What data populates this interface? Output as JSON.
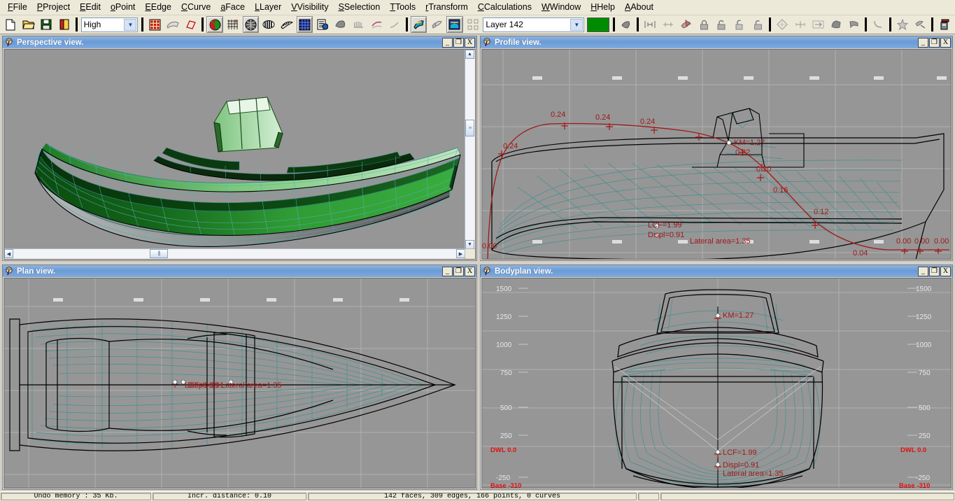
{
  "app": {
    "title": "Hull Design"
  },
  "menubar": {
    "items": [
      {
        "label": "File",
        "accel": "F"
      },
      {
        "label": "Project",
        "accel": "P"
      },
      {
        "label": "Edit",
        "accel": "E"
      },
      {
        "label": "Point",
        "accel": "o"
      },
      {
        "label": "Edge",
        "accel": "E"
      },
      {
        "label": "Curve",
        "accel": "C"
      },
      {
        "label": "Face",
        "accel": "a"
      },
      {
        "label": "Layer",
        "accel": "L"
      },
      {
        "label": "Visibility",
        "accel": "V"
      },
      {
        "label": "Selection",
        "accel": "S"
      },
      {
        "label": "Tools",
        "accel": "T"
      },
      {
        "label": "Transform",
        "accel": "r"
      },
      {
        "label": "Calculations",
        "accel": "C"
      },
      {
        "label": "Window",
        "accel": "W"
      },
      {
        "label": "Help",
        "accel": "H"
      },
      {
        "label": "About",
        "accel": "A"
      }
    ]
  },
  "toolbar": {
    "precision": {
      "value": "High",
      "name": "precision-select"
    },
    "layer": {
      "value": "Layer 142",
      "name": "layer-select"
    },
    "layer_color": "#008c00",
    "buttons": [
      {
        "name": "new-file-icon"
      },
      {
        "name": "open-file-icon"
      },
      {
        "name": "save-file-icon"
      },
      {
        "name": "export-file-icon"
      },
      {
        "name": "control-net-icon"
      },
      {
        "name": "interior-edges-icon"
      },
      {
        "name": "control-curves-icon"
      },
      {
        "name": "shade-icon"
      },
      {
        "name": "grid-icon"
      },
      {
        "name": "developability-icon"
      },
      {
        "name": "zebra-icon"
      },
      {
        "name": "curvature-icon"
      },
      {
        "name": "wireframe-icon"
      },
      {
        "name": "calculate-hydrostatics-icon"
      },
      {
        "name": "stations-icon"
      },
      {
        "name": "buttocks-icon"
      },
      {
        "name": "waterlines-icon"
      },
      {
        "name": "diagonals-icon"
      },
      {
        "name": "flowlines-icon"
      },
      {
        "name": "markers-icon"
      },
      {
        "name": "hydrostatics-icon"
      },
      {
        "name": "new-layer-icon"
      },
      {
        "name": "add-point-icon"
      },
      {
        "name": "collapse-point-icon"
      },
      {
        "name": "insert-plane-icon"
      },
      {
        "name": "extrude-edge-icon"
      },
      {
        "name": "lock-points-icon"
      },
      {
        "name": "unlock-points-icon"
      },
      {
        "name": "unlock-all-icon"
      },
      {
        "name": "intersect-layers-icon"
      },
      {
        "name": "mirror-icon"
      },
      {
        "name": "align-icon"
      },
      {
        "name": "rotate-icon"
      },
      {
        "name": "move-icon"
      },
      {
        "name": "fit-curve-icon"
      },
      {
        "name": "delete-icon"
      },
      {
        "name": "edge-crease-icon"
      },
      {
        "name": "print-icon"
      }
    ]
  },
  "panes": {
    "perspective": {
      "title": "Perspective view.",
      "icon": "viewport-icon"
    },
    "profile": {
      "title": "Profile view.",
      "icon": "viewport-icon"
    },
    "plan": {
      "title": "Plan view.",
      "icon": "viewport-icon"
    },
    "bodyplan": {
      "title": "Bodyplan view.",
      "icon": "viewport-icon"
    }
  },
  "window_buttons": {
    "minimize": "_",
    "maximize": "❐",
    "close": "X"
  },
  "hydrostatics": {
    "km_label": "KM=1.27",
    "lcf_label": "LCF=1.99",
    "displ_label": "Displ=0.91",
    "lateral_area_label": "Lateral area=1.35",
    "values": {
      "km": 1.27,
      "lcf": 1.99,
      "displ": 0.91,
      "lateral_area": 1.35
    }
  },
  "profile_curve": {
    "name": "km-curve",
    "color": "#a01818",
    "labels": [
      "0.24",
      "0.24",
      "0.24",
      "0.24",
      "0.22",
      "0.20",
      "0.16",
      "0.12",
      "0.04",
      "0.00",
      "0.00",
      "0.00"
    ],
    "left_label": "0.00"
  },
  "bodyplan_scale": {
    "ticks": [
      "1500",
      "1250",
      "1000",
      "750",
      "500",
      "250",
      "-250"
    ],
    "dwl_label": "DWL 0.0",
    "base_label": "Base -310"
  },
  "statusbar": {
    "undo_memory": "Undo memory : 35 Kb.",
    "incr_distance": "Incr. distance: 0.10",
    "geometry": "142 faces, 309 edges, 166 points, 0 curves",
    "extra": "",
    "empty": ""
  }
}
